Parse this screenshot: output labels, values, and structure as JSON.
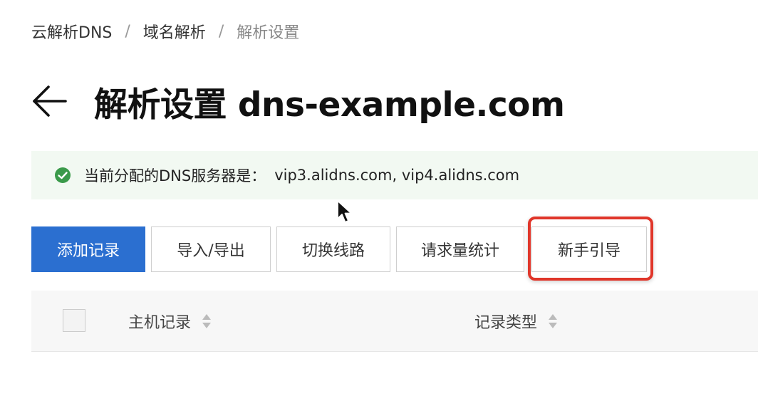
{
  "breadcrumb": {
    "items": [
      "云解析DNS",
      "域名解析",
      "解析设置"
    ],
    "separator": "/"
  },
  "header": {
    "title": "解析设置 dns-example.com",
    "back_icon": "arrow-left-icon"
  },
  "notice": {
    "label": "当前分配的DNS服务器是：",
    "servers": "vip3.alidns.com, vip4.alidns.com",
    "icon": "check-circle-icon",
    "icon_color": "#3a9a4a",
    "background": "#f2f9f2"
  },
  "toolbar": {
    "add_record": "添加记录",
    "import_export": "导入/导出",
    "switch_line": "切换线路",
    "request_stats": "请求量统计",
    "beginner_guide": "新手引导",
    "primary_color": "#2b6fd0",
    "highlight_color": "#e0362a"
  },
  "table": {
    "columns": [
      "主机记录",
      "记录类型"
    ]
  }
}
